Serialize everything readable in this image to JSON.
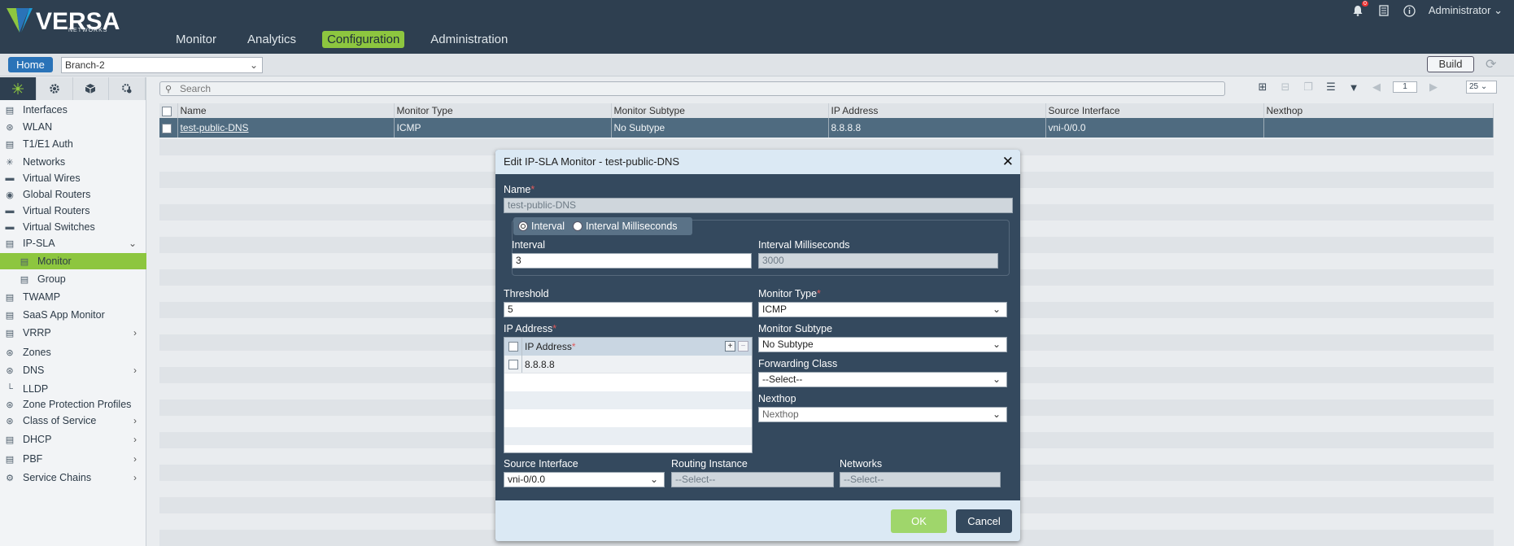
{
  "brand": {
    "name": "VERSA",
    "sub": "NETWORKS"
  },
  "nav": {
    "tabs": [
      "Monitor",
      "Analytics",
      "Configuration",
      "Administration"
    ],
    "active": "Configuration"
  },
  "header": {
    "notification_count": "0",
    "user": "Administrator"
  },
  "toolbar": {
    "home_label": "Home",
    "branch_value": "Branch-2",
    "build_label": "Build"
  },
  "sidebar": {
    "items": [
      {
        "label": "Interfaces",
        "icon": "interfaces-icon"
      },
      {
        "label": "WLAN",
        "icon": "wifi-icon"
      },
      {
        "label": "T1/E1 Auth",
        "icon": "t1-icon"
      },
      {
        "label": "Networks",
        "icon": "network-icon"
      },
      {
        "label": "Virtual Wires",
        "icon": "wire-icon"
      },
      {
        "label": "Global Routers",
        "icon": "router-icon"
      },
      {
        "label": "Virtual Routers",
        "icon": "router-icon"
      },
      {
        "label": "Virtual Switches",
        "icon": "switch-icon"
      },
      {
        "label": "IP-SLA",
        "icon": "monitor-icon"
      },
      {
        "label": "Monitor",
        "icon": "monitor-icon"
      },
      {
        "label": "Group",
        "icon": "monitor-icon"
      },
      {
        "label": "TWAMP",
        "icon": "monitor-icon"
      },
      {
        "label": "SaaS App Monitor",
        "icon": "monitor-icon"
      },
      {
        "label": "VRRP",
        "icon": "vrrp-icon"
      },
      {
        "label": "Zones",
        "icon": "zone-icon"
      },
      {
        "label": "DNS",
        "icon": "dns-icon"
      },
      {
        "label": "LLDP",
        "icon": "lldp-icon"
      },
      {
        "label": "Zone Protection Profiles",
        "icon": "shield-icon"
      },
      {
        "label": "Class of Service",
        "icon": "cos-icon"
      },
      {
        "label": "DHCP",
        "icon": "dhcp-icon"
      },
      {
        "label": "PBF",
        "icon": "pbf-icon"
      },
      {
        "label": "Service Chains",
        "icon": "gear-icon"
      }
    ]
  },
  "grid": {
    "search_placeholder": "Search",
    "page": "1",
    "page_size": "25",
    "columns": [
      "Name",
      "Monitor Type",
      "Monitor Subtype",
      "IP Address",
      "Source Interface",
      "Nexthop"
    ],
    "rows": [
      [
        "test-public-DNS",
        "ICMP",
        "No Subtype",
        "8.8.8.8",
        "vni-0/0.0",
        ""
      ]
    ]
  },
  "modal": {
    "title": "Edit IP-SLA Monitor - test-public-DNS",
    "name_label": "Name",
    "name_value": "test-public-DNS",
    "radio_interval": "Interval",
    "radio_interval_ms": "Interval Milliseconds",
    "interval_label": "Interval",
    "interval_value": "3",
    "interval_ms_label": "Interval Milliseconds",
    "interval_ms_value": "3000",
    "threshold_label": "Threshold",
    "threshold_value": "5",
    "monitor_type_label": "Monitor Type",
    "monitor_type_value": "ICMP",
    "ip_address_label": "IP Address",
    "ip_table_header": "IP Address",
    "ip_values": [
      "8.8.8.8"
    ],
    "monitor_subtype_label": "Monitor Subtype",
    "monitor_subtype_value": "No Subtype",
    "forwarding_class_label": "Forwarding Class",
    "forwarding_class_value": "--Select--",
    "nexthop_label": "Nexthop",
    "nexthop_value": "Nexthop",
    "source_interface_label": "Source Interface",
    "source_interface_value": "vni-0/0.0",
    "routing_instance_label": "Routing Instance",
    "routing_instance_value": "--Select--",
    "networks_label": "Networks",
    "networks_value": "--Select--",
    "ok_label": "OK",
    "cancel_label": "Cancel"
  },
  "colors": {
    "header_bg": "#2e3f50",
    "accent": "#8dc63f",
    "modal_bg": "#34495e",
    "selected_row": "#4f6b80"
  }
}
